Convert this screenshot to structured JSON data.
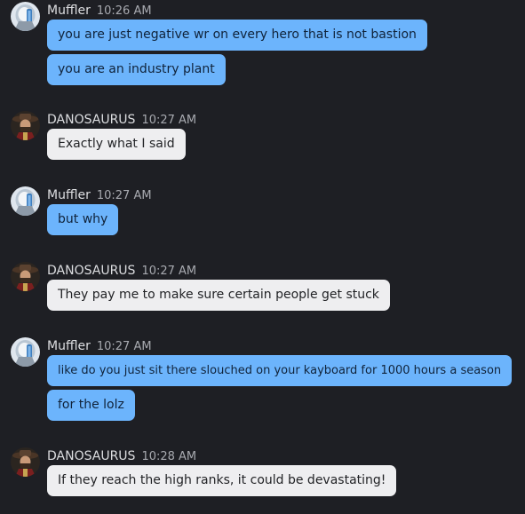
{
  "colors": {
    "background": "#1e1f24",
    "outgoing_bubble": "#6cb4fc",
    "incoming_bubble": "#eeeef0",
    "username": "#dcdde0",
    "timestamp": "#a8aab0"
  },
  "groups": [
    {
      "user": "Muffler",
      "avatar": "muffler-avatar",
      "time": "10:26 AM",
      "messages": [
        "you are just negative wr on every hero that is not bastion",
        "you are an industry plant"
      ]
    },
    {
      "user": "DANOSAURUS",
      "avatar": "danosaurus-avatar",
      "time": "10:27 AM",
      "messages": [
        "Exactly what I said"
      ]
    },
    {
      "user": "Muffler",
      "avatar": "muffler-avatar",
      "time": "10:27 AM",
      "messages": [
        "but why"
      ]
    },
    {
      "user": "DANOSAURUS",
      "avatar": "danosaurus-avatar",
      "time": "10:27 AM",
      "messages": [
        "They pay me to make sure certain people get stuck"
      ]
    },
    {
      "user": "Muffler",
      "avatar": "muffler-avatar",
      "time": "10:27 AM",
      "messages": [
        "like do you just sit there slouched on your kayboard for 1000 hours a season",
        "for the lolz"
      ]
    },
    {
      "user": "DANOSAURUS",
      "avatar": "danosaurus-avatar",
      "time": "10:28 AM",
      "messages": [
        "If they reach the high ranks, it could be devastating!"
      ]
    }
  ]
}
